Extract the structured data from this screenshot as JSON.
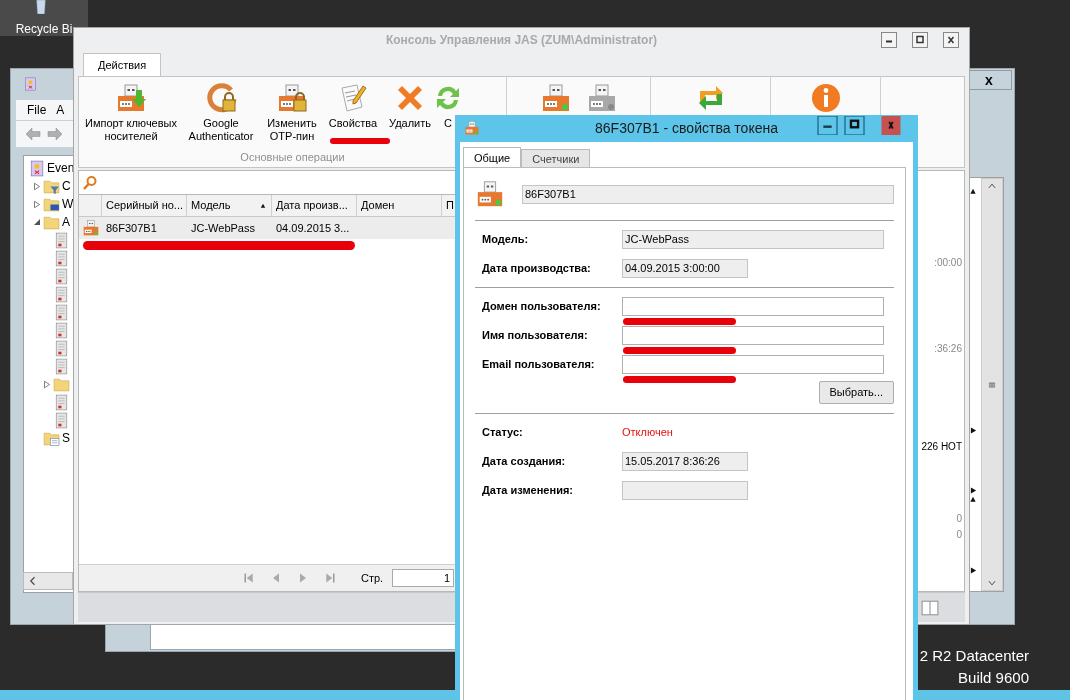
{
  "desktop": {
    "recycle_bin_label": "Recycle Bi",
    "os_edition": "2 R2 Datacenter",
    "os_build": "Build 9600"
  },
  "event_viewer": {
    "close": "x",
    "menu": [
      "File",
      "A"
    ],
    "tree": [
      {
        "label": "Even",
        "kind": "viewer",
        "children": [
          {
            "label": "C",
            "kind": "filter-folder",
            "expanded": false
          },
          {
            "label": "W",
            "kind": "windows-folder",
            "expanded": false
          },
          {
            "label": "A",
            "kind": "folder",
            "expanded": true,
            "children": [
              {
                "kind": "log"
              },
              {
                "kind": "log"
              },
              {
                "kind": "log"
              },
              {
                "kind": "log"
              },
              {
                "kind": "log"
              },
              {
                "kind": "log"
              },
              {
                "kind": "log"
              },
              {
                "kind": "log"
              },
              {
                "kind": "folder",
                "expanded": false
              },
              {
                "kind": "log"
              },
              {
                "kind": "log"
              }
            ]
          },
          {
            "label": "S",
            "kind": "subscription-folder"
          }
        ]
      }
    ]
  },
  "console": {
    "title": "Консоль Управления JAS (ZUM\\Administrator)",
    "tabs": [
      {
        "label": "Действия",
        "selected": true
      }
    ],
    "ribbon_groups": [
      {
        "label": "Основные операции",
        "buttons": [
          {
            "kind": "import",
            "label": "Импорт ключевых носителей"
          },
          {
            "kind": "google",
            "label": "Google Authenticator"
          },
          {
            "kind": "lock",
            "label": "Изменить OTP-пин"
          },
          {
            "kind": "properties",
            "label": "Свойства"
          },
          {
            "kind": "delete",
            "label": "Удалить"
          },
          {
            "kind": "refresh",
            "label": "С"
          }
        ]
      },
      {
        "buttons": [
          {
            "kind": "token-on"
          },
          {
            "kind": "token-off"
          }
        ]
      },
      {
        "buttons": [
          {
            "kind": "sync"
          }
        ]
      },
      {
        "buttons": [
          {
            "kind": "info"
          }
        ]
      }
    ],
    "table": {
      "columns": [
        {
          "label": "Серийный но..."
        },
        {
          "label": "Модель",
          "sorted": true
        },
        {
          "label": "Дата произв..."
        },
        {
          "label": "Домен"
        },
        {
          "label": "П"
        }
      ],
      "rows": [
        {
          "selected": true,
          "cells": [
            "86F307B1",
            "JC-WebPass",
            "04.09.2015 3..."
          ]
        }
      ]
    },
    "pager": {
      "label": "Стр.",
      "page": "1"
    },
    "detail_fragments": [
      ":00:00",
      ":36:26",
      "226 HOT",
      "0",
      "0"
    ]
  },
  "dialog": {
    "title": "86F307B1 - свойства токена",
    "tabs": [
      {
        "label": "Общие",
        "selected": true
      },
      {
        "label": "Счетчики",
        "selected": false
      }
    ],
    "serial": "86F307B1",
    "sections": [
      {
        "fields": [
          {
            "label": "Модель:",
            "value": "JC-WebPass",
            "readonly": true
          },
          {
            "label": "Дата производства:",
            "value": "04.09.2015 3:00:00",
            "readonly": true
          }
        ]
      },
      {
        "fields": [
          {
            "label": "Домен пользователя:",
            "readonly": false,
            "redacted": true
          },
          {
            "label": "Имя пользователя:",
            "readonly": false,
            "redacted": true
          },
          {
            "label": "Email пользователя:",
            "readonly": false,
            "redacted": true
          }
        ],
        "button": "Выбрать..."
      },
      {
        "fields": [
          {
            "label": "Статус:",
            "value": "Отключен",
            "kind": "status"
          },
          {
            "label": "Дата создания:",
            "value": "15.05.2017 8:36:26",
            "readonly": true
          },
          {
            "label": "Дата изменения:",
            "readonly": true
          }
        ]
      }
    ]
  }
}
